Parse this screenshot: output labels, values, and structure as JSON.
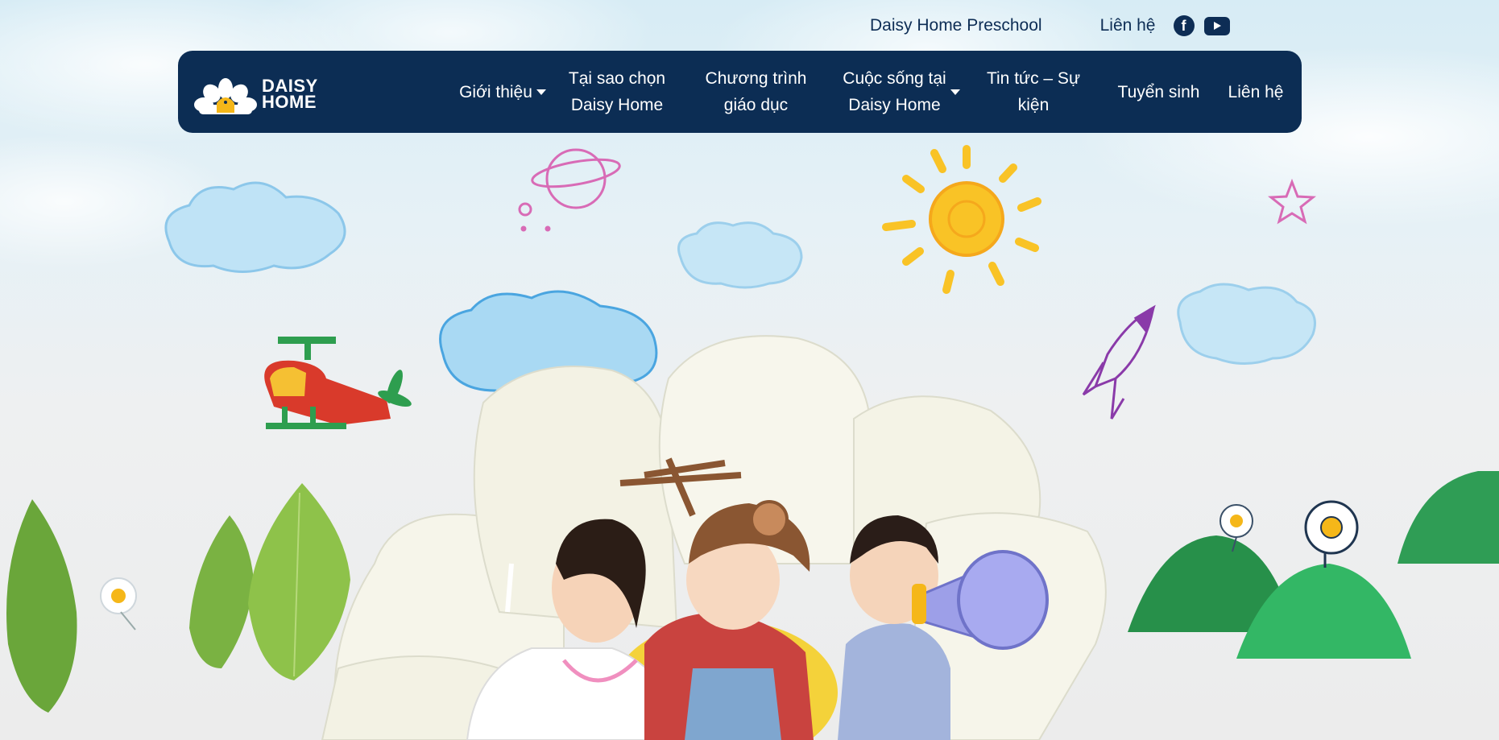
{
  "topbar": {
    "school_name": "Daisy Home Preschool",
    "contact_link": "Liên hệ",
    "facebook_icon": "facebook-icon",
    "youtube_icon": "youtube-icon"
  },
  "logo": {
    "line1": "DAISY",
    "line2": "HOME"
  },
  "nav": {
    "items": [
      {
        "label": "Giới thiệu",
        "dropdown": true
      },
      {
        "label_line1": "Tại sao chọn",
        "label_line2": "Daisy Home",
        "dropdown": false
      },
      {
        "label_line1": "Chương trình",
        "label_line2": "giáo dục",
        "dropdown": false
      },
      {
        "label_line1": "Cuộc sống tại",
        "label_line2": "Daisy Home",
        "dropdown": true
      },
      {
        "label_line1": "Tin tức – Sự",
        "label_line2": "kiện",
        "dropdown": false
      },
      {
        "label": "Tuyển sinh",
        "dropdown": false
      },
      {
        "label": "Liên hệ",
        "dropdown": false
      }
    ]
  },
  "colors": {
    "navy": "#0c2d54",
    "yellow": "#f5b719",
    "green": "#2fae5c",
    "sky": "#d7ecf5"
  }
}
